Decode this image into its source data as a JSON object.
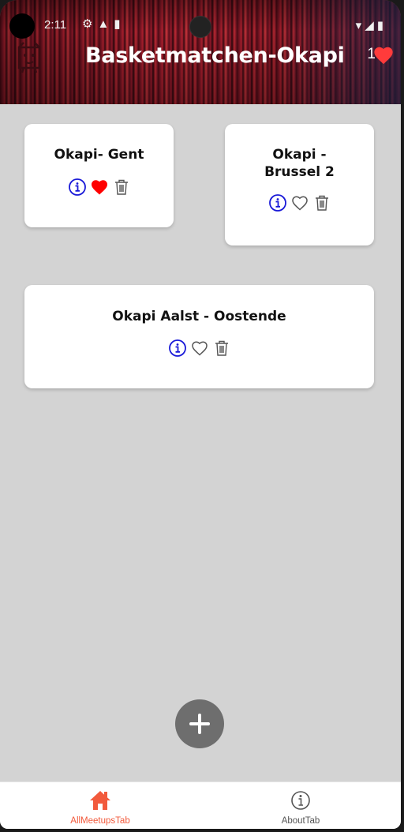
{
  "status_bar": {
    "time": "2:11"
  },
  "header": {
    "title": "Basketmatchen-Okapi",
    "favorites_count": "1"
  },
  "meetups": [
    {
      "title": "Okapi- Gent",
      "favorite": true
    },
    {
      "title": "Okapi - Brussel 2",
      "favorite": false
    },
    {
      "title": "Okapi Aalst - Oostende",
      "favorite": false
    }
  ],
  "tabs": [
    {
      "label": "AllMeetupsTab",
      "active": true
    },
    {
      "label": "AboutTab",
      "active": false
    }
  ],
  "colors": {
    "active_tab": "#f25a3c",
    "inactive_tab": "#555555",
    "info_icon": "#1a1ad8",
    "heart_filled": "#ff0000",
    "outline_icon": "#555555",
    "background": "#d3d3d3",
    "fab": "#6e6e6e"
  },
  "icons": {
    "info": "info-circle-icon",
    "favorite": "heart-icon",
    "delete": "trash-icon",
    "add": "plus-icon",
    "home": "home-icon"
  }
}
